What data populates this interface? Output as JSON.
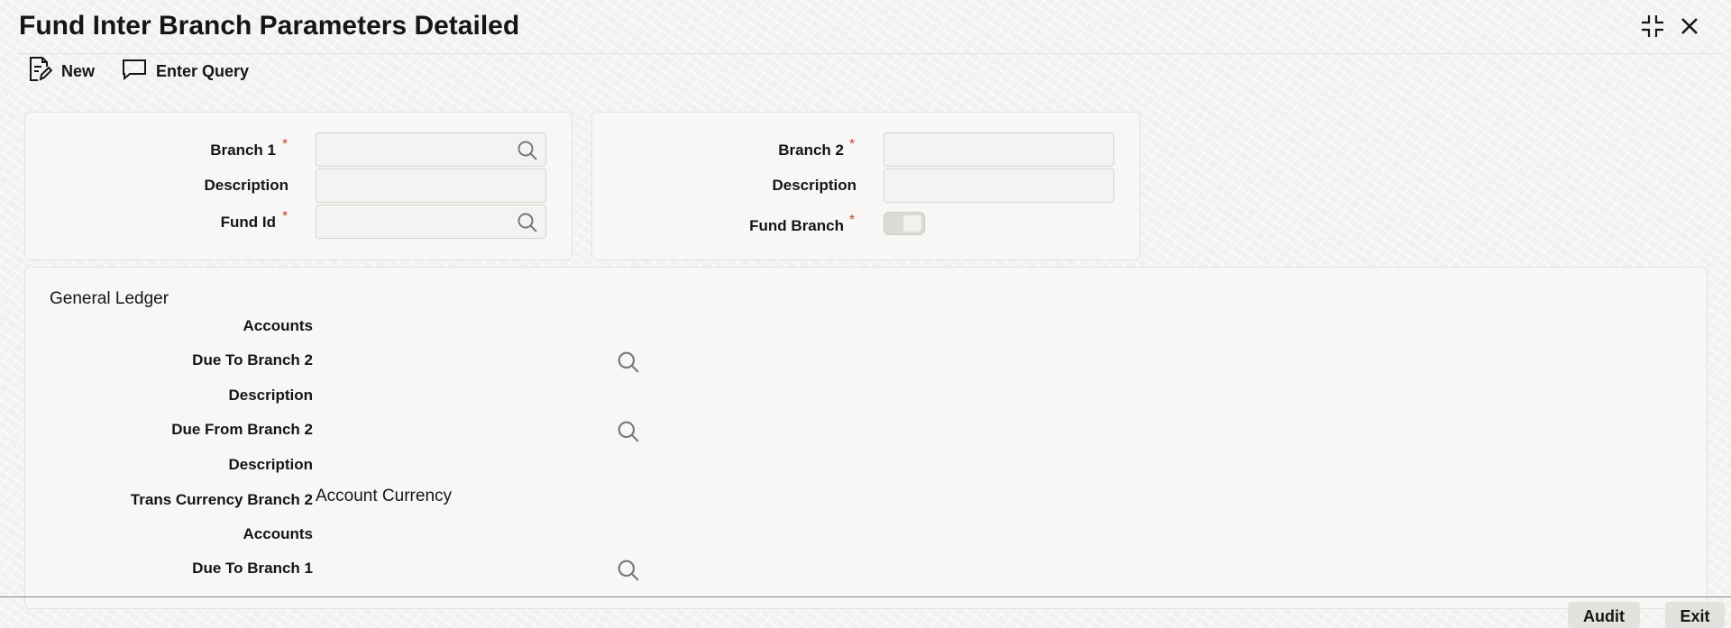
{
  "window": {
    "title": "Fund Inter Branch Parameters Detailed",
    "icons": [
      "collapse-icon",
      "close-icon"
    ]
  },
  "toolbar": {
    "new_label": "New",
    "enter_query_label": "Enter Query"
  },
  "header_left": {
    "branch1_label": "Branch 1",
    "description_label": "Description",
    "fund_id_label": "Fund Id",
    "branch1_value": "",
    "description_value": "",
    "fund_id_value": ""
  },
  "header_right": {
    "branch2_label": "Branch 2",
    "description_label": "Description",
    "fund_branch_label": "Fund Branch",
    "branch2_value": "",
    "description_value": "",
    "fund_branch_on": false
  },
  "required_mark": "*",
  "general_ledger": {
    "title": "General Ledger",
    "accounts_label_1": "Accounts",
    "due_to_branch2_label": "Due To Branch 2",
    "description_label_1": "Description",
    "due_from_branch2_label": "Due From Branch 2",
    "description_label_2": "Description",
    "trans_currency_branch2_label": "Trans Currency Branch 2",
    "trans_currency_value": "Account Currency",
    "accounts_label_2": "Accounts",
    "due_to_branch1_label": "Due To Branch 1"
  },
  "footer": {
    "audit_label": "Audit",
    "exit_label": "Exit"
  },
  "colors": {
    "required": "#c74634",
    "text": "#161513",
    "panel": "#f8f7f6"
  }
}
